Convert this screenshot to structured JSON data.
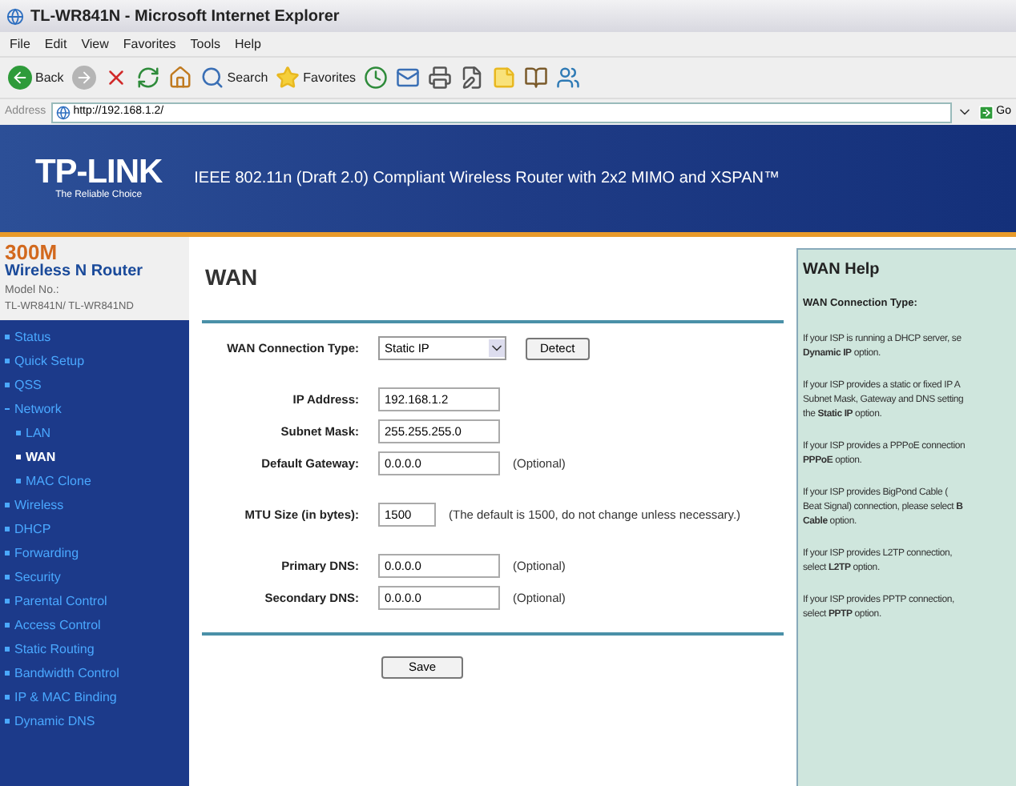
{
  "window": {
    "title": "TL-WR841N - Microsoft Internet Explorer"
  },
  "menu": [
    "File",
    "Edit",
    "View",
    "Favorites",
    "Tools",
    "Help"
  ],
  "toolbar": [
    {
      "kind": "back",
      "label": "Back"
    },
    {
      "kind": "forward"
    },
    {
      "kind": "stop"
    },
    {
      "kind": "refresh"
    },
    {
      "kind": "home"
    },
    {
      "kind": "search",
      "label": "Search"
    },
    {
      "kind": "favorites",
      "label": "Favorites"
    },
    {
      "kind": "history"
    },
    {
      "kind": "mail"
    },
    {
      "kind": "print"
    },
    {
      "kind": "edit"
    },
    {
      "kind": "notes"
    },
    {
      "kind": "research"
    },
    {
      "kind": "messenger"
    }
  ],
  "address": {
    "label": "Address",
    "value": "http://192.168.1.2/",
    "go": "Go"
  },
  "banner": {
    "logo": "TP-LINK",
    "tagline": "The Reliable Choice",
    "headline": "IEEE 802.11n (Draft 2.0) Compliant Wireless Router with 2x2 MIMO and XSPAN™"
  },
  "product": {
    "speed": "300M",
    "name": "Wireless N Router",
    "model_label": "Model No.:",
    "model": "TL-WR841N/ TL-WR841ND"
  },
  "sidebar": {
    "items": [
      {
        "label": "Status",
        "selected": false
      },
      {
        "label": "Quick Setup",
        "selected": false
      },
      {
        "label": "QSS",
        "selected": false
      },
      {
        "label": "Network",
        "selected": false,
        "expanded": true,
        "children": [
          {
            "label": "LAN",
            "selected": false
          },
          {
            "label": "WAN",
            "selected": true
          },
          {
            "label": "MAC Clone",
            "selected": false
          }
        ]
      },
      {
        "label": "Wireless",
        "selected": false
      },
      {
        "label": "DHCP",
        "selected": false
      },
      {
        "label": "Forwarding",
        "selected": false
      },
      {
        "label": "Security",
        "selected": false
      },
      {
        "label": "Parental Control",
        "selected": false
      },
      {
        "label": "Access Control",
        "selected": false
      },
      {
        "label": "Static Routing",
        "selected": false
      },
      {
        "label": "Bandwidth Control",
        "selected": false
      },
      {
        "label": "IP & MAC Binding",
        "selected": false
      },
      {
        "label": "Dynamic DNS",
        "selected": false
      }
    ]
  },
  "form": {
    "title": "WAN",
    "groups": [
      [
        {
          "label": "WAN Connection Type:",
          "kind": "select",
          "value": "Static IP",
          "button": "Detect"
        }
      ],
      [
        {
          "label": "IP Address:",
          "kind": "text",
          "value": "192.168.1.2"
        },
        {
          "label": "Subnet Mask:",
          "kind": "text",
          "value": "255.255.255.0"
        },
        {
          "label": "Default Gateway:",
          "kind": "text",
          "value": "0.0.0.0",
          "note": "(Optional)"
        }
      ],
      [
        {
          "label": "MTU Size (in bytes):",
          "kind": "short",
          "value": "1500",
          "note": "(The default is 1500, do not change unless necessary.)"
        }
      ],
      [
        {
          "label": "Primary DNS:",
          "kind": "text",
          "value": "0.0.0.0",
          "note": "(Optional)"
        },
        {
          "label": "Secondary DNS:",
          "kind": "text",
          "value": "0.0.0.0",
          "note": "(Optional)"
        }
      ]
    ],
    "save": "Save"
  },
  "help": {
    "title": "WAN Help",
    "subtitle": "WAN Connection Type:",
    "paragraphs": [
      [
        "If your ISP is running a DHCP server, se",
        "**Dynamic IP** option."
      ],
      [
        "If your ISP provides a static or fixed IP A",
        "Subnet Mask, Gateway and DNS setting",
        "the **Static IP** option."
      ],
      [
        "If your ISP provides a PPPoE connection",
        "**PPPoE** option."
      ],
      [
        "If your ISP provides BigPond Cable (",
        "Beat Signal) connection, please select **B**",
        "**Cable** option."
      ],
      [
        "If your ISP provides L2TP connection,",
        "select **L2TP** option."
      ],
      [
        "If your ISP provides PPTP connection,",
        "select **PPTP** option."
      ]
    ]
  }
}
